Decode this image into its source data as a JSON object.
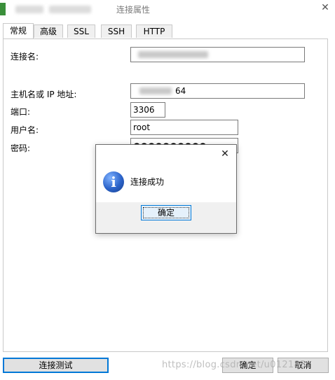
{
  "window": {
    "title": "连接属性",
    "close_glyph": "✕"
  },
  "tabs": [
    {
      "label": "常规"
    },
    {
      "label": "高级"
    },
    {
      "label": "SSL"
    },
    {
      "label": "SSH"
    },
    {
      "label": "HTTP"
    }
  ],
  "form": {
    "connection_name_label": "连接名:",
    "host_label": "主机名或 IP 地址:",
    "host_value_prefix": "",
    "host_value_suffix": "64",
    "port_label": "端口:",
    "port_value": "3306",
    "username_label": "用户名:",
    "username_value": "root",
    "password_label": "密码:",
    "password_value": "●●●●●●●●●●"
  },
  "dialog": {
    "message": "连接成功",
    "ok_label": "确定",
    "close_glyph": "✕",
    "icon_glyph": "i"
  },
  "footer": {
    "test_label": "连接测试",
    "ok_label": "确定",
    "cancel_label": "取消"
  },
  "watermark": "https://blog.csdn.net/u012183"
}
